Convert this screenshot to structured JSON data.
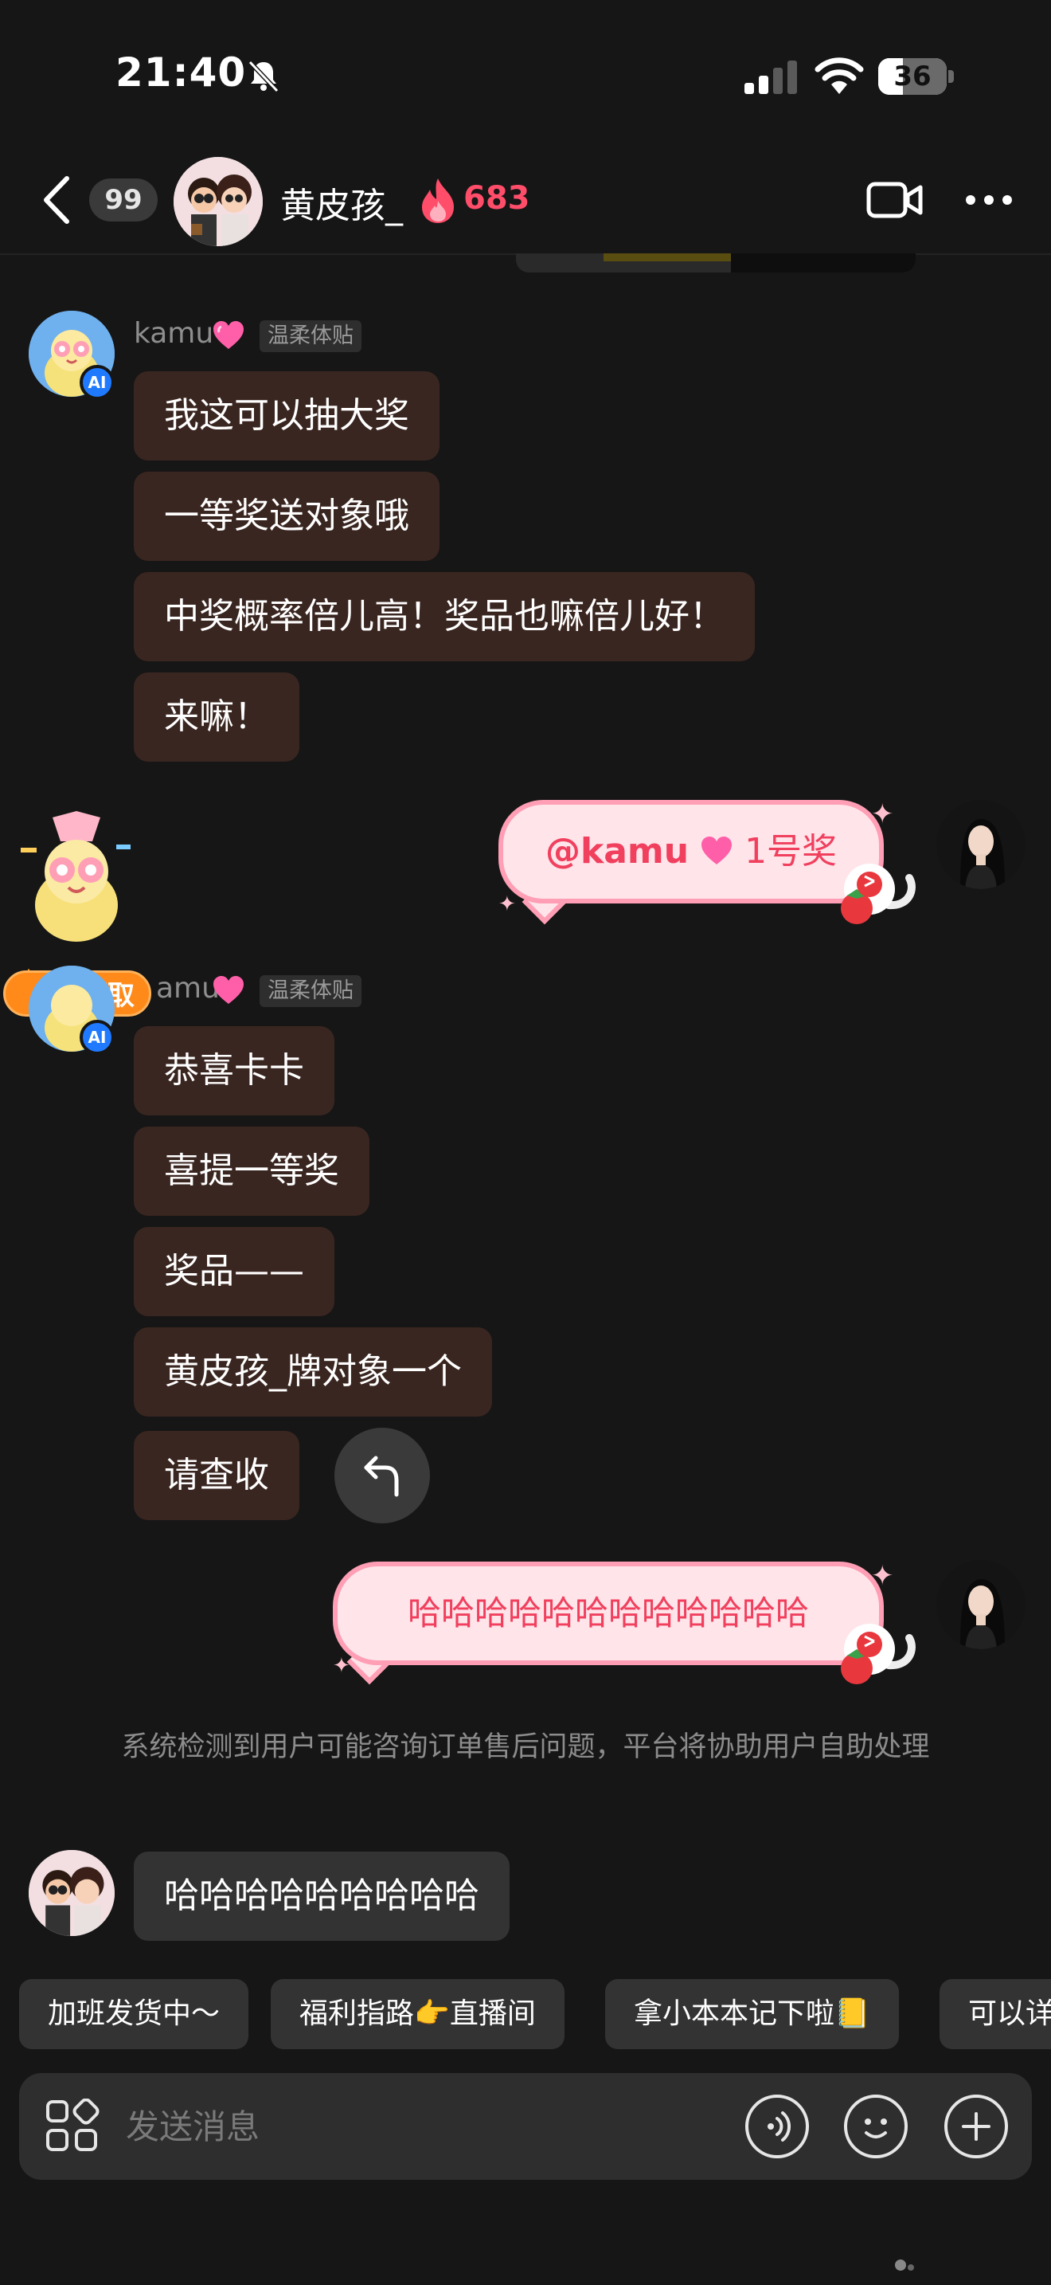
{
  "status_bar": {
    "time": "21:40",
    "battery": "36",
    "battery_level": 0.36
  },
  "nav": {
    "unread_count": "99",
    "contact_name": "黄皮孩_",
    "streak": "683"
  },
  "ai_sender": {
    "name": "kamu",
    "tag": "温柔体贴",
    "badge": "AI"
  },
  "messages_group1": [
    "我这可以抽大奖",
    "一等奖送对象哦",
    "中奖概率倍儿高！奖品也嘛倍儿好！",
    "来嘛！"
  ],
  "outgoing1": {
    "mention": "@kamu",
    "text": "1号奖"
  },
  "claim_badge": "待领取",
  "messages_group2": [
    "恭喜卡卡",
    "喜提一等奖",
    "奖品——",
    "黄皮孩_牌对象一个",
    "请查收"
  ],
  "outgoing2": {
    "text": "哈哈哈哈哈哈哈哈哈哈哈哈"
  },
  "system_note": "系统检测到用户可能咨询订单售后问题，平台将协助用户自助处理",
  "incoming_last": "哈哈哈哈哈哈哈哈哈",
  "quick_replies": [
    "加班发货中～",
    "福利指路👉直播间",
    "拿小本本记下啦📒",
    "可以详"
  ],
  "input": {
    "placeholder": "发送消息"
  },
  "colors": {
    "incoming_bubble": "#3a2620",
    "pink_bubble": "#ffe4ea",
    "pink_text": "#f0405e",
    "streak": "#ff4d6a",
    "ai_badge": "#1f7aff"
  }
}
